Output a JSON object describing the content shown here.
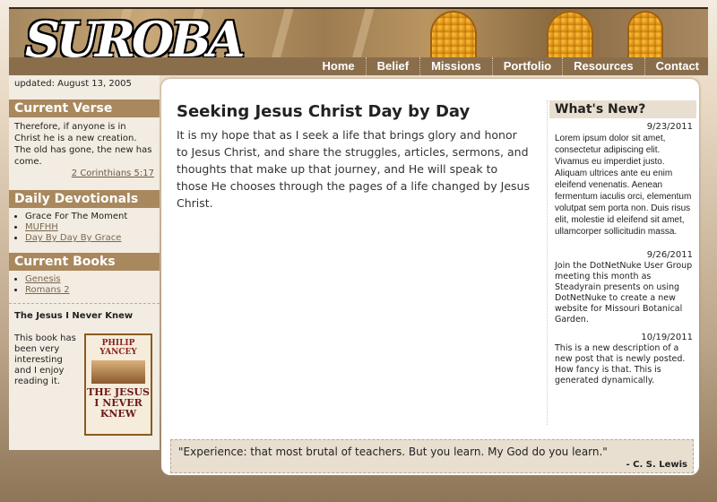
{
  "header": {
    "logo_text": "SUROBA"
  },
  "nav": {
    "items": [
      "Home",
      "Belief",
      "Missions",
      "Portfolio",
      "Resources",
      "Contact"
    ]
  },
  "sidebar": {
    "updated": "updated: August 13, 2005",
    "current_verse": {
      "heading": "Current Verse",
      "text": "Therefore, if anyone is in Christ he is a new creation. The old has gone, the new has come.",
      "reference": "2 Corinthians 5:17"
    },
    "daily_devotionals": {
      "heading": "Daily Devotionals",
      "items": [
        "Grace For The Moment",
        "MUFHH",
        "Day By Day By Grace"
      ]
    },
    "current_books": {
      "heading": "Current Books",
      "items": [
        "Genesis",
        "Romans 2"
      ],
      "featured_title": "The Jesus I Never Knew",
      "featured_text": "This book has been very interesting and I enjoy reading it.",
      "cover_author": "PHILIP YANCEY",
      "cover_title": "THE JESUS I NEVER KNEW"
    }
  },
  "main": {
    "title": "Seeking Jesus Christ Day by Day",
    "body": "It is my hope that as I seek a life that brings glory and honor to Jesus Christ, and share the struggles, articles, sermons, and thoughts that make up that journey, and He will speak to those He chooses through the pages of a life changed by Jesus Christ."
  },
  "whats_new": {
    "heading": "What's New?",
    "items": [
      {
        "date": "9/23/2011",
        "text": "Lorem ipsum dolor sit amet, consectetur adipiscing elit. Vivamus eu imperdiet justo. Aliquam ultrices ante eu enim eleifend venenatis. Aenean fermentum iaculis orci, elementum volutpat sem porta non. Duis risus elit, molestie id eleifend sit amet, ullamcorper sollicitudin massa."
      },
      {
        "date": "9/26/2011",
        "text": "Join the DotNetNuke User Group meeting this month as Steadyrain presents on using DotNetNuke to create a new website for Missouri Botanical Garden."
      },
      {
        "date": "10/19/2011",
        "text": "This is a new description of a new post that is newly posted.  How fancy is that. This is generated dynamically."
      }
    ]
  },
  "quote": {
    "text": "\"Experience: that most brutal of teachers. But you learn. My God do you learn.\"",
    "author": "- C. S. Lewis"
  }
}
